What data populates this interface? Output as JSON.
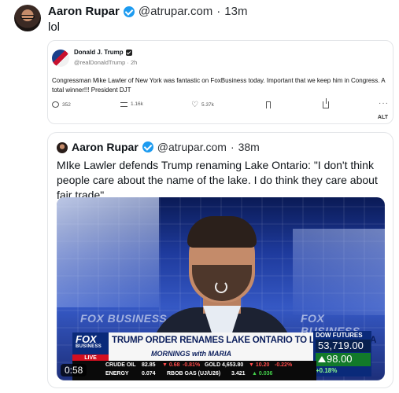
{
  "post": {
    "author_name": "Aaron Rupar",
    "handle": "@atrupar.com",
    "separator": "·",
    "time": "13m",
    "text": "lol"
  },
  "quoted_truth": {
    "author_name": "Donald J. Trump",
    "handle": "@realDonaldTrump",
    "separator": "·",
    "time": "2h",
    "text": "Congressman Mike Lawler of New York was fantastic on FoxBusiness today. Important that we keep him in Congress. A total winner!!! President DJT",
    "replies": "352",
    "retruths": "1.16k",
    "likes": "5.37k",
    "alt_label": "ALT"
  },
  "quoted_post": {
    "author_name": "Aaron Rupar",
    "handle": "@atrupar.com",
    "separator": "·",
    "time": "38m",
    "text": "MIke Lawler defends Trump renaming Lake Ontario: \"I don't think people care about the name of the lake. I do think they care about fair trade\"",
    "video": {
      "duration": "0:58",
      "wall_brand_left": "FOX BUSINESS",
      "wall_brand_right": "FOX BUSINESS",
      "network_logo_top": "FOX",
      "network_logo_bottom": "BUSINESS",
      "live_label": "LIVE",
      "headline": "TRUMP ORDER RENAMES LAKE ONTARIO TO LAKE AMERICA",
      "show_name": "MORNINGS with MARIA",
      "dow_title": "DOW FUTURES",
      "dow_value": "53,719.00",
      "dow_change": "98.00",
      "dow_percent": "+0.18%",
      "ticker": {
        "crude_label": "CRUDE OIL",
        "crude_value": "82.85",
        "crude_change": "▼ 0.68",
        "crude_percent": "-0.81%",
        "gold_label": "GOLD",
        "gold_value": "4,653.80",
        "gold_change": "▼ 10.20",
        "gold_percent": "-0.22%",
        "energy_label": "ENERGY",
        "rbob_value": "0.074",
        "rbob_label": "RBOB GAS (UJ/U26)",
        "rbob_price": "3.421",
        "rbob_change": "▲ 0.036"
      }
    }
  }
}
